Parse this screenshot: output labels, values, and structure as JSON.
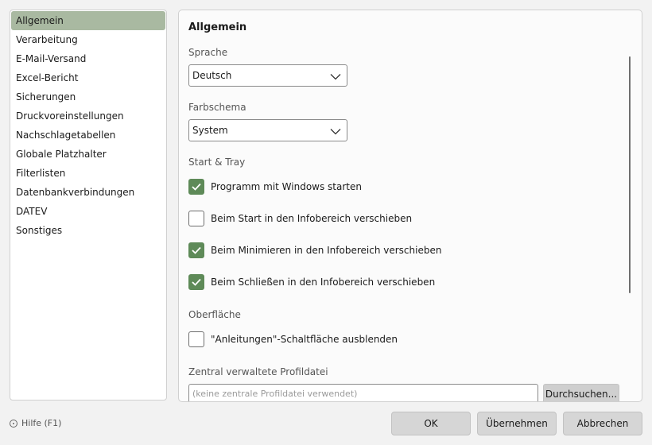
{
  "sidebar": {
    "items": [
      {
        "label": "Allgemein",
        "active": true
      },
      {
        "label": "Verarbeitung"
      },
      {
        "label": "E-Mail-Versand"
      },
      {
        "label": "Excel-Bericht"
      },
      {
        "label": "Sicherungen"
      },
      {
        "label": "Druckvoreinstellungen"
      },
      {
        "label": "Nachschlagetabellen"
      },
      {
        "label": "Globale Platzhalter"
      },
      {
        "label": "Filterlisten"
      },
      {
        "label": "Datenbankverbindungen"
      },
      {
        "label": "DATEV"
      },
      {
        "label": "Sonstiges"
      }
    ]
  },
  "panel": {
    "title": "Allgemein",
    "language": {
      "label": "Sprache",
      "value": "Deutsch"
    },
    "color_scheme": {
      "label": "Farbschema",
      "value": "System"
    },
    "start_tray": {
      "label": "Start & Tray",
      "options": [
        {
          "label": "Programm mit Windows starten",
          "checked": true
        },
        {
          "label": "Beim Start in den Infobereich verschieben",
          "checked": false
        },
        {
          "label": "Beim Minimieren in den Infobereich verschieben",
          "checked": true
        },
        {
          "label": "Beim Schließen in den Infobereich verschieben",
          "checked": true
        }
      ]
    },
    "surface": {
      "label": "Oberfläche",
      "options": [
        {
          "label": "\"Anleitungen\"-Schaltfläche ausblenden",
          "checked": false
        }
      ]
    },
    "profile": {
      "label": "Zentral verwaltete Profildatei",
      "placeholder": "(keine zentrale Profildatei verwendet)",
      "browse_label": "Durchsuchen..."
    }
  },
  "footer": {
    "help_label": "Hilfe (F1)",
    "ok_label": "OK",
    "apply_label": "Übernehmen",
    "cancel_label": "Abbrechen"
  },
  "colors": {
    "accent": "#5e8a58",
    "active_item_bg": "#a9b9a1"
  },
  "icons": {
    "help": "help-circle-icon",
    "dropdown": "chevron-down-icon",
    "check": "check-icon"
  }
}
